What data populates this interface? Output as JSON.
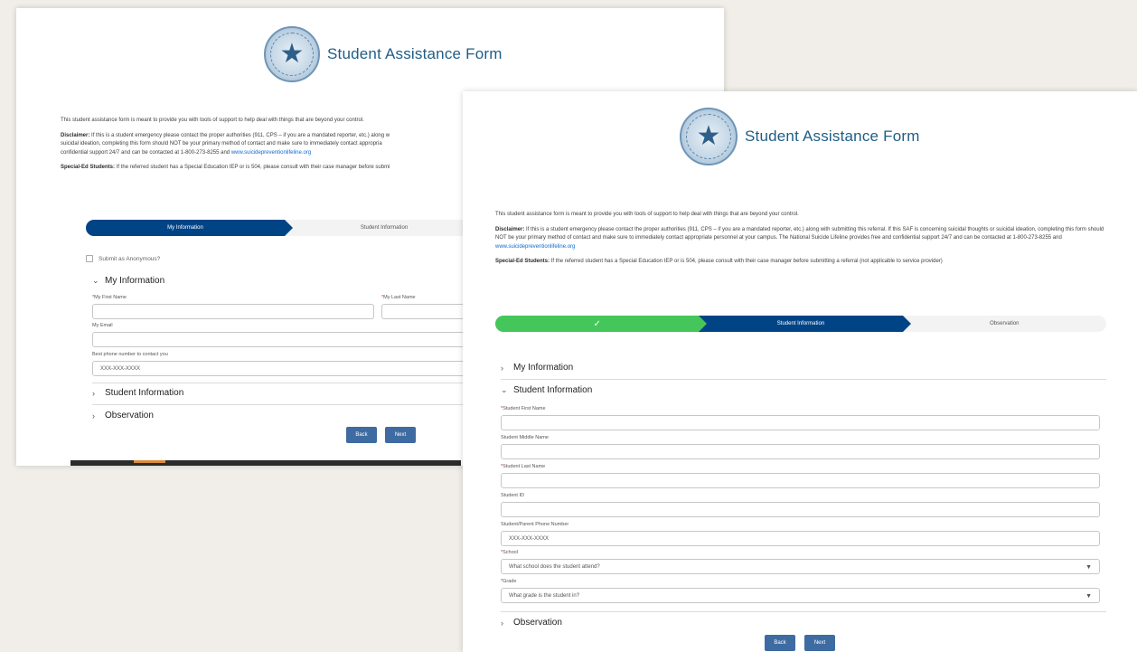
{
  "form_title": "Student Assistance Form",
  "intro": {
    "line1": "This student assistance form is meant to provide you with tools of support to help deal with things that are beyond your control.",
    "disclaimer_label": "Disclaimer:",
    "disclaimer_text": " If this is a student emergency please contact the proper authorities (911, CPS – if you are a mandated reporter, etc.) along with submitting this referral. If this SAF is concerning suicidal thoughts or suicidal ideation, completing this form should NOT be your primary method of contact and make sure to immediately contact appropriate personnel at your campus. The National Suicide Lifeline provides free and confidential support 24/7 and can be contacted at 1-800-273-8255 and ",
    "disclaimer_link": "www.suicidepreventionlifeline.org",
    "sped_label": "Special-Ed Students:",
    "sped_text": " If the referred student has a Special Education IEP or is 504, please consult with their case manager before submitting a referral (not applicable to service provider)",
    "back_disclaimer_text": " If this is a student emergency please contact the proper authorities (911, CPS – if you are a mandated reporter, etc.) along w",
    "back_disclaimer_line2": "suicidal ideation, completing this form should NOT be your primary method of contact and make sure to immediately contact appropria",
    "back_disclaimer_line3": "confidential support 24/7 and can be contacted at 1-800-273-8255 and ",
    "back_sped_text": " If the referred student has a Special Education IEP or is 504, please consult with their case manager before submi"
  },
  "steps": {
    "my_information": "My Information",
    "student_information": "Student Information",
    "observation": "Observation",
    "done_icon": "check-icon"
  },
  "back_form": {
    "anonymous_label": "Submit as Anonymous?",
    "section_my_info": "My Information",
    "first_name_label": "My First Name",
    "last_name_label": "My Last Name",
    "email_label": "My Email",
    "phone_label": "Best phone number to contact you",
    "phone_placeholder": "XXX-XXX-XXXX",
    "section_student_info": "Student Information",
    "section_observation": "Observation"
  },
  "front_form": {
    "section_my_info": "My Information",
    "section_student_info": "Student Information",
    "first_name_label": "Student First Name",
    "middle_name_label": "Student Middle Name",
    "last_name_label": "Student Last Name",
    "id_label": "Student ID",
    "phone_label": "Student/Parent Phone Number",
    "phone_placeholder": "XXX-XXX-XXXX",
    "school_label": "School",
    "school_placeholder": "What school does the student attend?",
    "grade_label": "Grade",
    "grade_placeholder": "What grade is the student in?",
    "section_observation": "Observation"
  },
  "buttons": {
    "back": "Back",
    "next": "Next"
  },
  "required_mark": "*",
  "colors": {
    "brand_blue": "#014486",
    "step_done": "#45c65a",
    "button": "#3e6ba1",
    "title": "#1f5d86"
  }
}
